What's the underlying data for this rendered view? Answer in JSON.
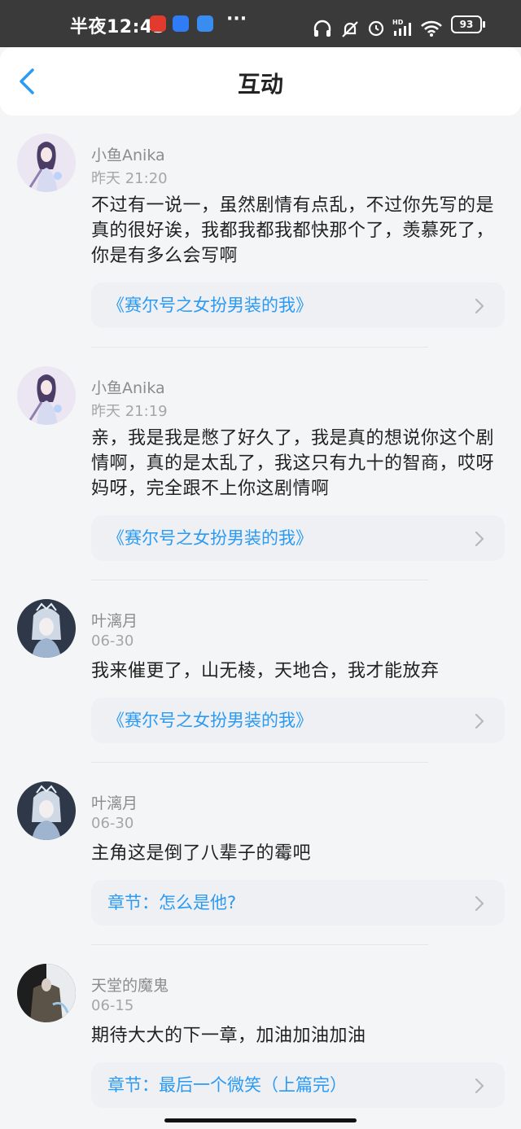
{
  "status_bar": {
    "time": "半夜12:43",
    "more": "···",
    "battery": "93"
  },
  "header": {
    "title": "互动"
  },
  "colors": {
    "accent": "#2b9af3",
    "background": "#f4f5f7"
  },
  "comments": [
    {
      "author": "小鱼Anika",
      "time": "昨天 21:20",
      "text": "不过有一说一，虽然剧情有点乱，不过你先写的是真的很好诶，我都我都我都快那个了，羡慕死了，你是有多么会写啊",
      "link": "《赛尔号之女扮男装的我》"
    },
    {
      "author": "小鱼Anika",
      "time": "昨天 21:19",
      "text": "亲，我是我是憋了好久了，我是真的想说你这个剧情啊，真的是太乱了，我这只有九十的智商，哎呀妈呀，完全跟不上你这剧情啊",
      "link": "《赛尔号之女扮男装的我》"
    },
    {
      "author": "叶漓月",
      "time": "06-30",
      "text": "我来催更了，山无棱，天地合，我才能放弃",
      "link": "《赛尔号之女扮男装的我》"
    },
    {
      "author": "叶漓月",
      "time": "06-30",
      "text": "主角这是倒了八辈子的霉吧",
      "link": "章节：怎么是他?"
    },
    {
      "author": "天堂的魔鬼",
      "time": "06-15",
      "text": "期待大大的下一章，加油加油加油",
      "link": "章节：最后一个微笑（上篇完）"
    }
  ]
}
